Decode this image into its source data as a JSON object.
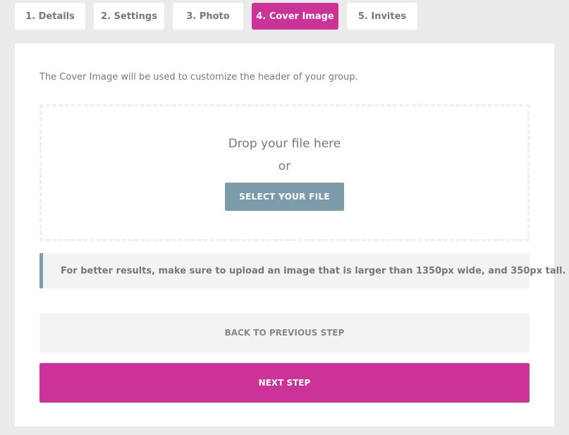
{
  "tabs": [
    {
      "label": "1. Details"
    },
    {
      "label": "2. Settings"
    },
    {
      "label": "3. Photo"
    },
    {
      "label": "4. Cover Image"
    },
    {
      "label": "5. Invites"
    }
  ],
  "active_tab": "4. Cover Image",
  "intro_text": "The Cover Image will be used to customize the header of your group.",
  "dropzone": {
    "drop_text": "Drop your file here",
    "or_text": "or",
    "select_label": "SELECT YOUR FILE"
  },
  "hint_text": "For better results, make sure to upload an image that is larger than 1350px wide, and 350px tall.",
  "buttons": {
    "back_label": "BACK TO PREVIOUS STEP",
    "next_label": "NEXT STEP"
  },
  "colors": {
    "accent": "#cc3399",
    "secondary": "#7d9caa",
    "background": "#ebebeb",
    "panel": "#ffffff",
    "muted_panel": "#f3f3f3",
    "text": "#777777"
  }
}
